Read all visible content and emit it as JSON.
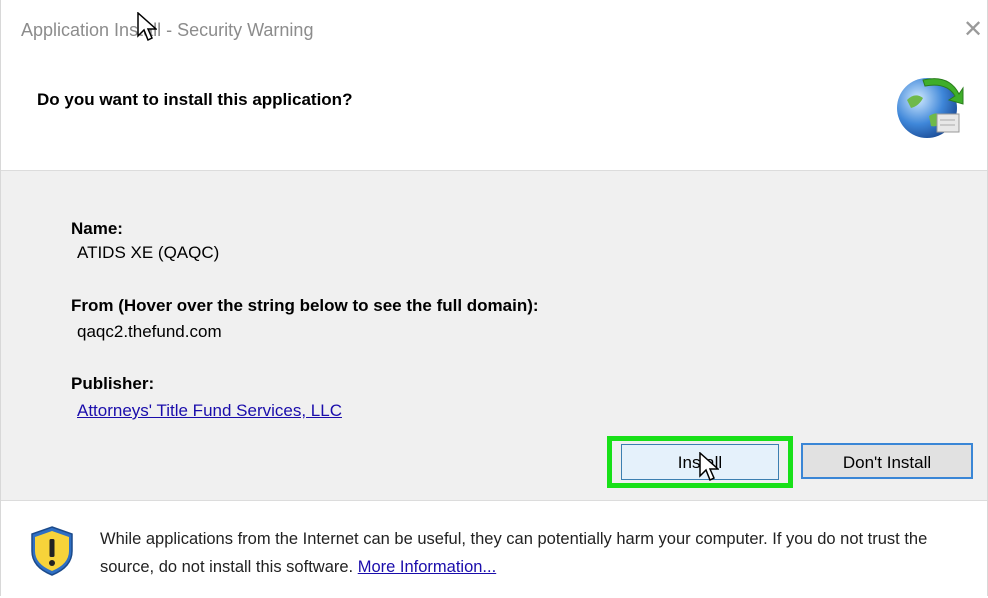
{
  "window": {
    "title": "Application Install - Security Warning"
  },
  "header": {
    "question": "Do you want to install this application?"
  },
  "details": {
    "name_label": "Name:",
    "name_value": "ATIDS XE (QAQC)",
    "from_label": "From (Hover over the string below to see the full domain):",
    "from_value": "qaqc2.thefund.com",
    "publisher_label": "Publisher:",
    "publisher_value": "Attorneys' Title Fund Services, LLC"
  },
  "buttons": {
    "install": "Install",
    "dont_install": "Don't Install"
  },
  "footer": {
    "warning_text": "While applications from the Internet can be useful, they can potentially harm your computer. If you do not trust the source, do not install this software.",
    "more_info": "More Information..."
  },
  "colors": {
    "highlight": "#18e018",
    "link": "#1a0dab",
    "focus_border": "#3a86d6"
  },
  "icons": [
    "close-icon",
    "globe-install-icon",
    "warning-shield-icon",
    "mouse-cursor-icon"
  ]
}
